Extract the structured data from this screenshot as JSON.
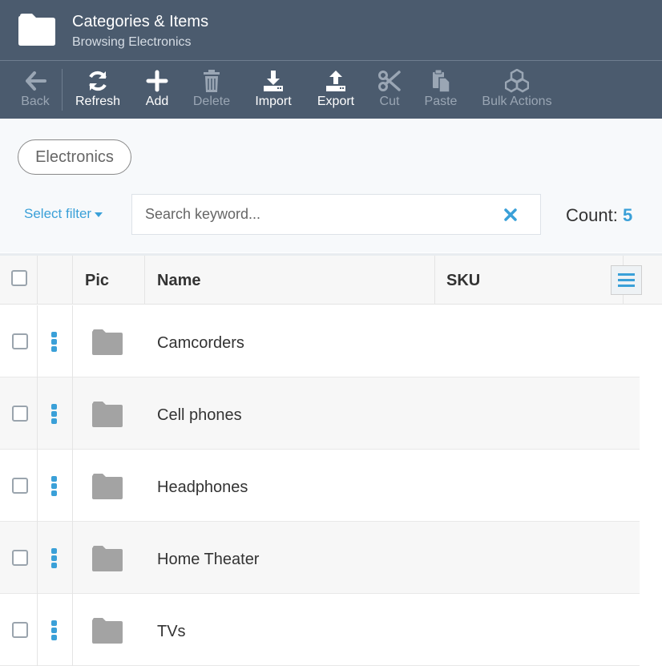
{
  "header": {
    "title": "Categories & Items",
    "subtitle": "Browsing Electronics",
    "icon": "folder-icon"
  },
  "toolbar": {
    "buttons": [
      {
        "label": "Back",
        "icon": "arrow-left-icon",
        "enabled": false
      },
      {
        "label": "Refresh",
        "icon": "refresh-icon",
        "enabled": true
      },
      {
        "label": "Add",
        "icon": "plus-icon",
        "enabled": true
      },
      {
        "label": "Delete",
        "icon": "trash-icon",
        "enabled": false
      },
      {
        "label": "Import",
        "icon": "download-icon",
        "enabled": true
      },
      {
        "label": "Export",
        "icon": "upload-icon",
        "enabled": true
      },
      {
        "label": "Cut",
        "icon": "scissors-icon",
        "enabled": false
      },
      {
        "label": "Paste",
        "icon": "paste-icon",
        "enabled": false
      },
      {
        "label": "Bulk Actions",
        "icon": "cubes-icon",
        "enabled": false
      }
    ]
  },
  "breadcrumb": {
    "label": "Electronics"
  },
  "filter": {
    "select_label": "Select filter",
    "search_placeholder": "Search keyword...",
    "search_value": ""
  },
  "count": {
    "label": "Count:",
    "value": "5"
  },
  "table": {
    "columns": [
      "Pic",
      "Name",
      "SKU"
    ],
    "rows": [
      {
        "name": "Camcorders",
        "sku": "",
        "pic": "folder-icon"
      },
      {
        "name": "Cell phones",
        "sku": "",
        "pic": "folder-icon"
      },
      {
        "name": "Headphones",
        "sku": "",
        "pic": "folder-icon"
      },
      {
        "name": "Home Theater",
        "sku": "",
        "pic": "folder-icon"
      },
      {
        "name": "TVs",
        "sku": "",
        "pic": "folder-icon"
      }
    ]
  },
  "colors": {
    "header_bg": "#4b5b6e",
    "accent": "#3aa0d8",
    "disabled_text": "#9aa6b4"
  }
}
